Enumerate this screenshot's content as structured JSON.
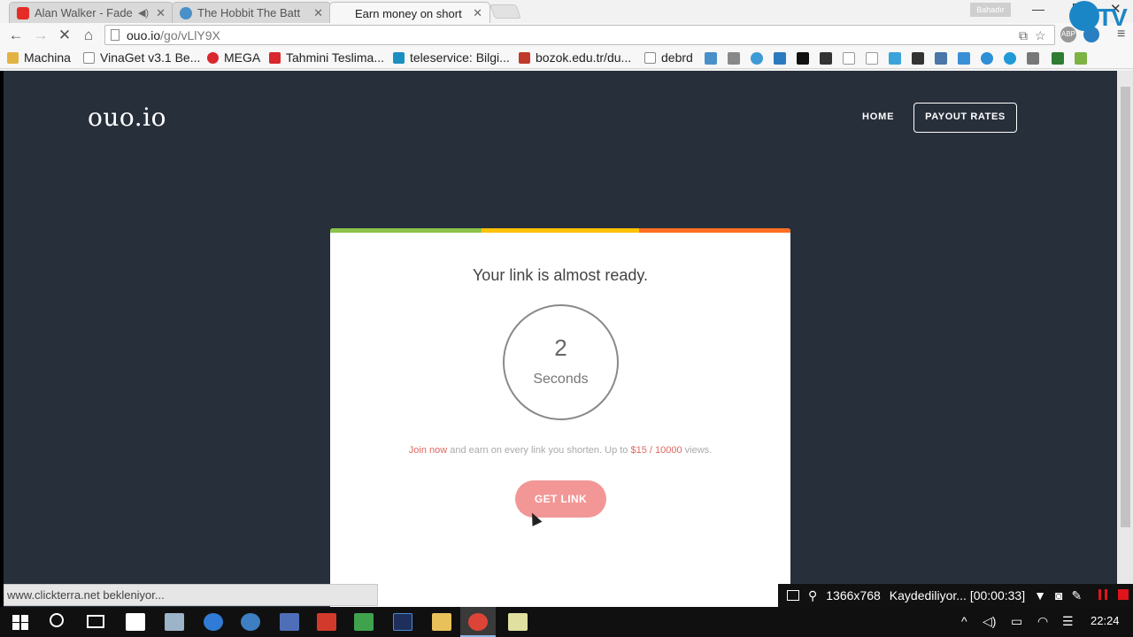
{
  "browser": {
    "tabs": [
      {
        "title": "Alan Walker - Fade",
        "favicon_color": "#e52d27",
        "has_audio": true
      },
      {
        "title": "The Hobbit The Batt",
        "favicon_color": "#4a90c8",
        "has_audio": false
      },
      {
        "title": "Earn money on short",
        "favicon_color": "#ffffff",
        "has_audio": false,
        "active": true
      }
    ],
    "profile_name": "Bahadır",
    "address": {
      "host": "ouo.io",
      "path": "/go/vLlY9X"
    },
    "bookmarks": [
      {
        "label": "Machina",
        "icon": "folder-icon",
        "color": "#e3b341"
      },
      {
        "label": "VinaGet v3.1 Be...",
        "icon": "page-icon",
        "color": "#ffffff"
      },
      {
        "label": "MEGA",
        "icon": "mega-icon",
        "color": "#d9272e"
      },
      {
        "label": "Tahmini Teslima...",
        "icon": "cart-icon",
        "color": "#d9272e"
      },
      {
        "label": "teleservice: Bilgi...",
        "icon": "t-icon",
        "color": "#1c8fc1"
      },
      {
        "label": "bozok.edu.tr/du...",
        "icon": "bozok-icon",
        "color": "#c0392b"
      },
      {
        "label": "debrd",
        "icon": "page-icon",
        "color": "#ffffff"
      }
    ]
  },
  "site": {
    "logo": "ouo.io",
    "nav_home": "HOME",
    "nav_payout": "PAYOUT RATES",
    "stripe_colors": [
      "#8bc34a",
      "#ffc107",
      "#ff6f22"
    ]
  },
  "card": {
    "title": "Your link is almost ready.",
    "countdown_value": "2",
    "countdown_unit": "Seconds",
    "promo_join": "Join now",
    "promo_mid": " and earn on every link you shorten. Up to ",
    "promo_rate": "$15 / 10000",
    "promo_end": " views.",
    "button": "GET LINK"
  },
  "status_text": "www.clickterra.net bekleniyor...",
  "recorder": {
    "resolution": "1366x768",
    "status": "Kaydediliyor... [00:00:33]"
  },
  "taskbar": {
    "clock": "22:24"
  }
}
